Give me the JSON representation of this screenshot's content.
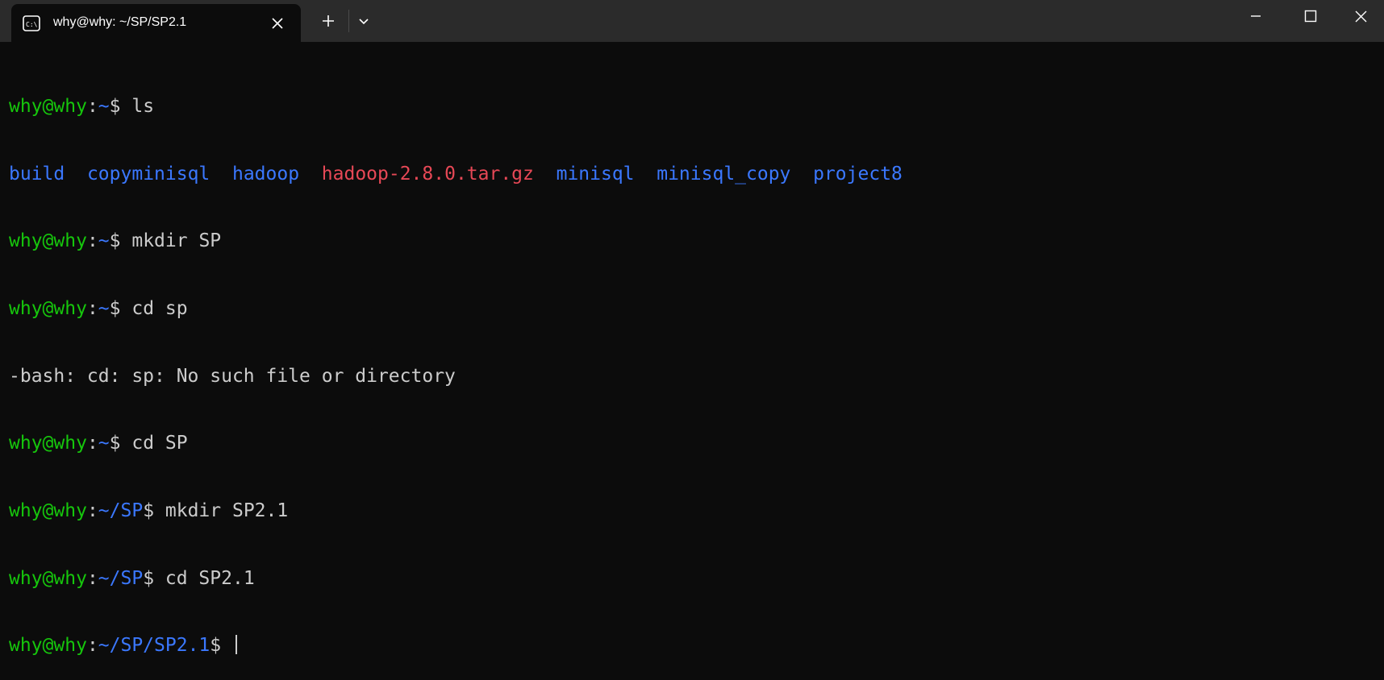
{
  "tab": {
    "title": "why@why: ~/SP/SP2.1",
    "icon": "terminal-icon"
  },
  "titlebar_buttons": {
    "new_tab": "plus-icon",
    "dropdown": "chevron-down-icon",
    "minimize": "minimize-icon",
    "maximize": "maximize-icon",
    "close": "close-icon"
  },
  "colors": {
    "prompt_user": "#16c60c",
    "prompt_path": "#3b78ff",
    "directory": "#3b78ff",
    "archive": "#e74856",
    "text": "#cccccc",
    "background": "#0c0c0c",
    "titlebar": "#2b2b2b"
  },
  "terminal": {
    "l1": {
      "user": "why@why",
      "sep": ":",
      "path": "~",
      "sym": "$ ",
      "cmd": "ls"
    },
    "ls_output": [
      "build",
      "copyminisql",
      "hadoop",
      "hadoop-2.8.0.tar.gz",
      "minisql",
      "minisql_copy",
      "project8"
    ],
    "l3": {
      "user": "why@why",
      "sep": ":",
      "path": "~",
      "sym": "$ ",
      "cmd": "mkdir SP"
    },
    "l4": {
      "user": "why@why",
      "sep": ":",
      "path": "~",
      "sym": "$ ",
      "cmd": "cd sp"
    },
    "error": "-bash: cd: sp: No such file or directory",
    "l6": {
      "user": "why@why",
      "sep": ":",
      "path": "~",
      "sym": "$ ",
      "cmd": "cd SP"
    },
    "l7": {
      "user": "why@why",
      "sep": ":",
      "path": "~/SP",
      "sym": "$ ",
      "cmd": "mkdir SP2.1"
    },
    "l8": {
      "user": "why@why",
      "sep": ":",
      "path": "~/SP",
      "sym": "$ ",
      "cmd": "cd SP2.1"
    },
    "l9": {
      "user": "why@why",
      "sep": ":",
      "path": "~/SP/SP2.1",
      "sym": "$ ",
      "cmd": ""
    }
  }
}
